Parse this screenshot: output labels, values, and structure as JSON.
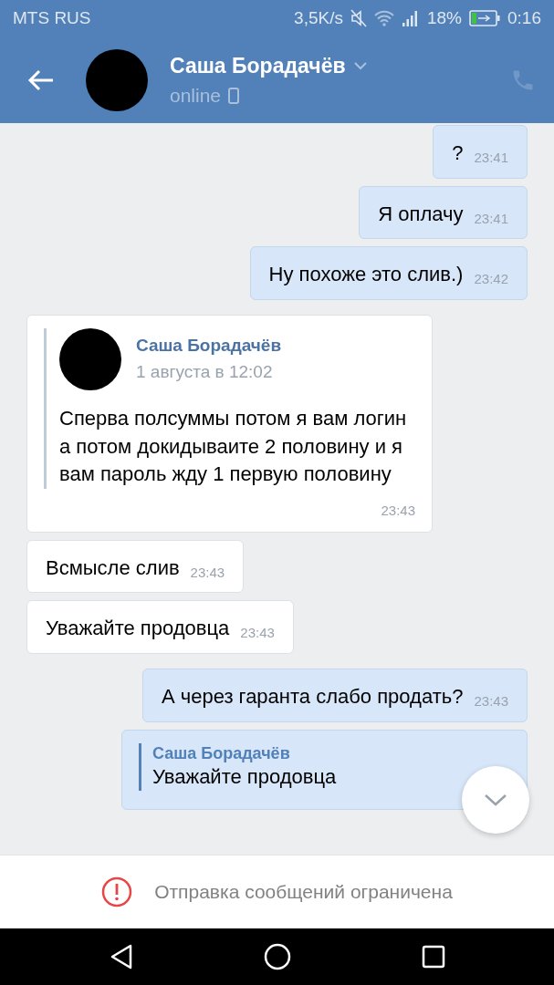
{
  "status_bar": {
    "carrier": "MTS RUS",
    "speed": "3,5K/s",
    "battery": "18%",
    "time": "0:16"
  },
  "header": {
    "name": "Саша Борадачёв",
    "presence": "online"
  },
  "messages": [
    {
      "kind": "outgoing",
      "text": "?",
      "time": "23:41"
    },
    {
      "kind": "outgoing",
      "text": "Я оплачу",
      "time": "23:41"
    },
    {
      "kind": "outgoing",
      "text": "Ну похоже это слив.)",
      "time": "23:42"
    },
    {
      "kind": "forwarded",
      "author": "Саша Борадачёв",
      "date": "1 августа в 12:02",
      "text": "Сперва полсуммы потом я вам логин а потом докидываите 2 половину и я вам пароль жду 1 первую половину",
      "time": "23:43"
    },
    {
      "kind": "incoming",
      "text": "Всмысле слив",
      "time": "23:43"
    },
    {
      "kind": "incoming",
      "text": "Уважайте продовца",
      "time": "23:43"
    },
    {
      "kind": "outgoing",
      "text": "А через гаранта слабо продать?",
      "time": "23:43"
    },
    {
      "kind": "reply",
      "author": "Саша Борадачёв",
      "text": "Уважайте продовца"
    }
  ],
  "footer": {
    "notice": "Отправка сообщений ограничена"
  }
}
